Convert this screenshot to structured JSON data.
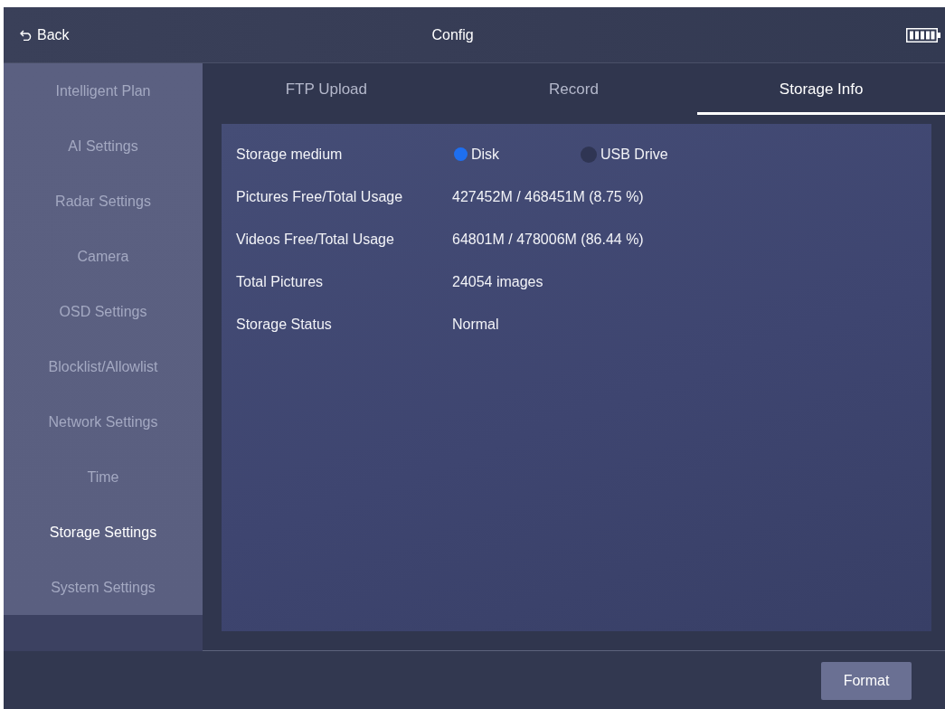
{
  "header": {
    "back_label": "Back",
    "title": "Config"
  },
  "sidebar": {
    "items": [
      {
        "label": "Intelligent Plan",
        "selected": false
      },
      {
        "label": "AI Settings",
        "selected": false
      },
      {
        "label": "Radar Settings",
        "selected": false
      },
      {
        "label": "Camera",
        "selected": false
      },
      {
        "label": "OSD Settings",
        "selected": false
      },
      {
        "label": "Blocklist/Allowlist",
        "selected": false
      },
      {
        "label": "Network Settings",
        "selected": false
      },
      {
        "label": "Time",
        "selected": false
      },
      {
        "label": "Storage Settings",
        "selected": true
      },
      {
        "label": "System Settings",
        "selected": false
      }
    ]
  },
  "tabs": [
    {
      "label": "FTP Upload",
      "selected": false
    },
    {
      "label": "Record",
      "selected": false
    },
    {
      "label": "Storage Info",
      "selected": true
    }
  ],
  "storage_info": {
    "rows": [
      {
        "kind": "radio",
        "label": "Storage medium",
        "options": [
          {
            "label": "Disk",
            "selected": true
          },
          {
            "label": "USB Drive",
            "selected": false
          }
        ]
      },
      {
        "kind": "text",
        "label": "Pictures Free/Total Usage",
        "value": "427452M / 468451M (8.75 %)"
      },
      {
        "kind": "text",
        "label": "Videos Free/Total Usage",
        "value": "64801M / 478006M (86.44 %)"
      },
      {
        "kind": "text",
        "label": "Total Pictures",
        "value": "24054 images"
      },
      {
        "kind": "text",
        "label": "Storage Status",
        "value": "Normal"
      }
    ]
  },
  "footer": {
    "buttons": [
      "Format"
    ]
  }
}
